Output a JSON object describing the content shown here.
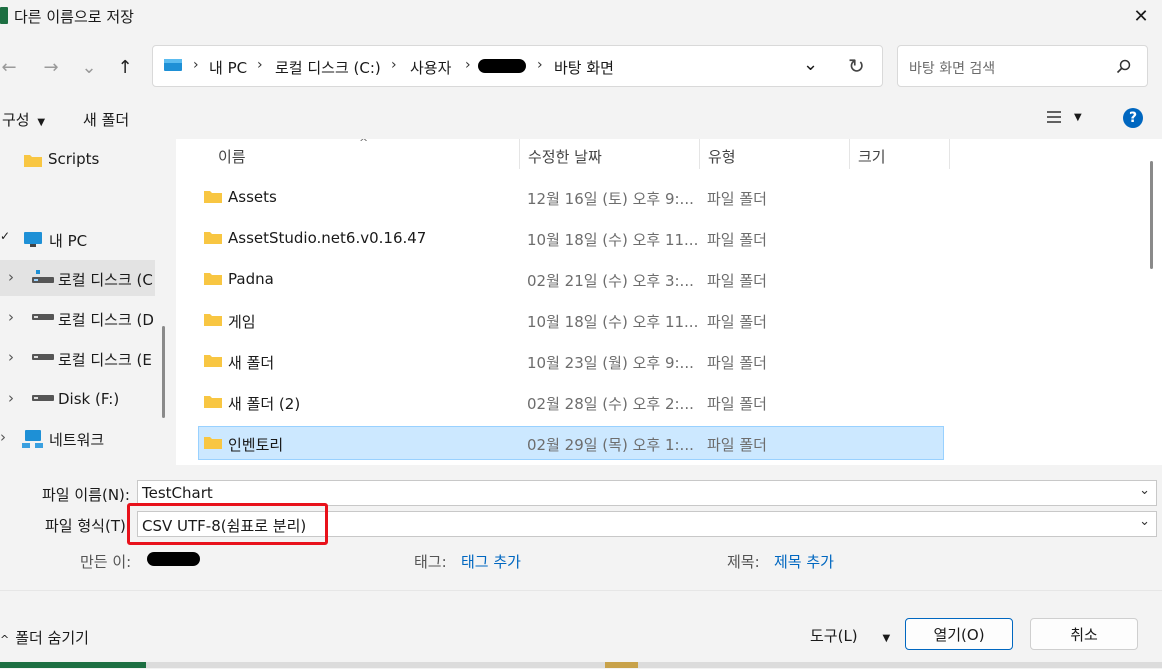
{
  "window": {
    "title": "다른 이름으로 저장",
    "close_glyph": "✕"
  },
  "nav": {
    "back_glyph": "←",
    "forward_glyph": "→",
    "recent_glyph": "⌄",
    "up_glyph": "↑",
    "breadcrumb": [
      "내 PC",
      "로컬 디스크 (C:)",
      "사용자",
      "바탕 화면"
    ],
    "breadcrumb_sep": "›",
    "dropdown_glyph": "⌄",
    "refresh_glyph": "↻",
    "search_placeholder": "바탕 화면 검색"
  },
  "toolbar": {
    "organize_label": "구성",
    "new_folder_label": "새 폴더",
    "help_glyph": "?"
  },
  "sidebar": {
    "items": [
      {
        "label": "Scripts"
      },
      {
        "label": "내 PC"
      },
      {
        "label": "로컬 디스크 (C"
      },
      {
        "label": "로컬 디스크 (D"
      },
      {
        "label": "로컬 디스크 (E"
      },
      {
        "label": "Disk (F:)"
      },
      {
        "label": "네트워크"
      }
    ]
  },
  "file_list": {
    "columns": [
      "이름",
      "수정한 날짜",
      "유형",
      "크기"
    ],
    "rows": [
      {
        "name": "Assets",
        "date": "12월 16일 (토) 오후 9:...",
        "type": "파일 폴더"
      },
      {
        "name": "AssetStudio.net6.v0.16.47",
        "date": "10월 18일 (수) 오후 11...",
        "type": "파일 폴더"
      },
      {
        "name": "Padna",
        "date": "02월 21일 (수) 오후 3:...",
        "type": "파일 폴더"
      },
      {
        "name": "게임",
        "date": "10월 18일 (수) 오후 11...",
        "type": "파일 폴더"
      },
      {
        "name": "새 폴더",
        "date": "10월 23일 (월) 오후 9:...",
        "type": "파일 폴더"
      },
      {
        "name": "새 폴더 (2)",
        "date": "02월 28일 (수) 오후 2:...",
        "type": "파일 폴더"
      },
      {
        "name": "인벤토리",
        "date": "02월 29일 (목) 오후 1:...",
        "type": "파일 폴더"
      }
    ]
  },
  "form": {
    "filename_label": "파일 이름(N):",
    "filename_value": "TestChart",
    "filetype_label": "파일 형식(T)",
    "filetype_value": "CSV UTF-8(쉼표로 분리)",
    "author_label": "만든 이:",
    "tags_label": "태그:",
    "tags_link": "태그 추가",
    "title_label": "제목:",
    "title_link": "제목 추가"
  },
  "footer": {
    "hide_folders_label": "폴더 숨기기",
    "tools_label": "도구(L)",
    "open_label": "열기(O)",
    "cancel_label": "취소"
  },
  "colors": {
    "accent": "#0067c0",
    "selection": "#cce8ff",
    "highlight": "#e8111b",
    "folder": "#f8c642"
  }
}
